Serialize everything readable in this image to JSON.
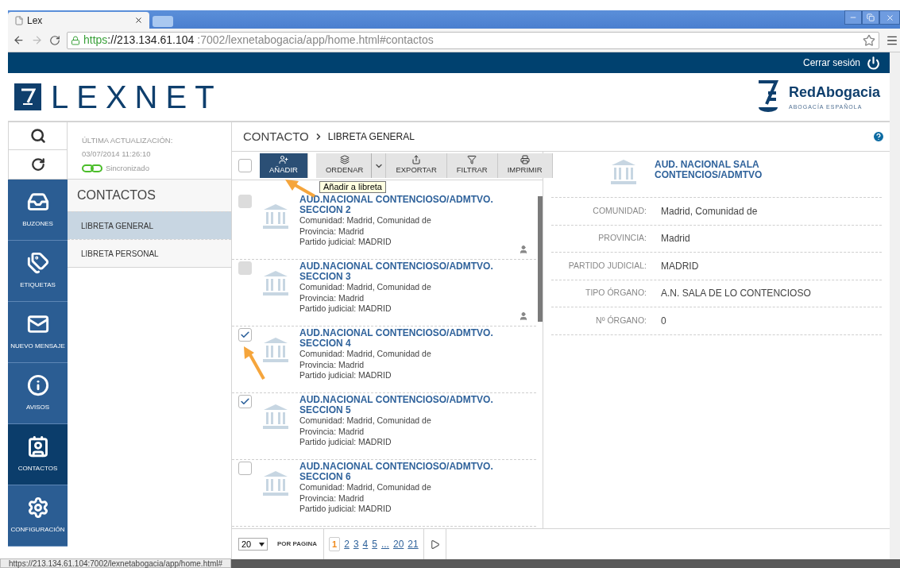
{
  "browser": {
    "tab_title": "Lex",
    "url_scheme": "https",
    "url_host": "://213.134.61.104",
    "url_rest": ":7002/lexnetabogacia/app/home.html#contactos",
    "status_url": "https://213.134.61.104:7002/lexnetabogacia/app/home.html#"
  },
  "header": {
    "logout": "Cerrar sesión",
    "brand": "LEXNET",
    "partner": "RedAbogacia",
    "partner_sub": "ABOGACÍA ESPAÑOLA"
  },
  "sidebar": {
    "items": [
      {
        "label": "BUZONES",
        "kind": "inbox",
        "selected": false
      },
      {
        "label": "ETIQUETAS",
        "kind": "tag",
        "selected": false
      },
      {
        "label": "NUEVO MENSAJE",
        "kind": "mail",
        "selected": false
      },
      {
        "label": "AVISOS",
        "kind": "info",
        "selected": false
      },
      {
        "label": "CONTACTOS",
        "kind": "contacts",
        "selected": true
      },
      {
        "label": "CONFIGURACIÓN",
        "kind": "settings",
        "selected": false
      }
    ]
  },
  "sync": {
    "label": "ÚLTIMA ACTUALIZACIÓN:",
    "time": "03/07/2014 11:26:10",
    "status": "Sincronizado"
  },
  "section": {
    "title": "CONTACTOS",
    "items": [
      {
        "label": "LIBRETA GENERAL",
        "selected": true
      },
      {
        "label": "LIBRETA PERSONAL",
        "selected": false
      }
    ]
  },
  "breadcrumb": [
    "CONTACTO",
    "LIBRETA GENERAL"
  ],
  "toolbar": {
    "select_all_checked": false,
    "buttons": [
      {
        "label": "AÑADIR",
        "kind": "add",
        "primary": true,
        "dropdown": false
      },
      {
        "label": "ORDENAR",
        "kind": "sort",
        "primary": false,
        "dropdown": true
      },
      {
        "label": "EXPORTAR",
        "kind": "export",
        "primary": false,
        "dropdown": false
      },
      {
        "label": "FILTRAR",
        "kind": "filter",
        "primary": false,
        "dropdown": false
      },
      {
        "label": "IMPRIMIR",
        "kind": "print",
        "primary": false,
        "dropdown": false
      }
    ],
    "tooltip": "Añadir a libreta"
  },
  "contacts": [
    {
      "title": "AUD.NACIONAL CONTENCIOSO/ADMTVO. SECCION 2",
      "lines": [
        "Comunidad: Madrid, Comunidad de",
        "Provincia: Madrid",
        "Partido judicial: MADRID"
      ],
      "checked": false,
      "disabled": true,
      "personal": true
    },
    {
      "title": "AUD.NACIONAL CONTENCIOSO/ADMTVO. SECCION 3",
      "lines": [
        "Comunidad: Madrid, Comunidad de",
        "Provincia: Madrid",
        "Partido judicial: MADRID"
      ],
      "checked": false,
      "disabled": true,
      "personal": true
    },
    {
      "title": "AUD.NACIONAL CONTENCIOSO/ADMTVO. SECCION 4",
      "lines": [
        "Comunidad: Madrid, Comunidad de",
        "Provincia: Madrid",
        "Partido judicial: MADRID"
      ],
      "checked": true,
      "disabled": false,
      "personal": false
    },
    {
      "title": "AUD.NACIONAL CONTENCIOSO/ADMTVO. SECCION 5",
      "lines": [
        "Comunidad: Madrid, Comunidad de",
        "Provincia: Madrid",
        "Partido judicial: MADRID"
      ],
      "checked": true,
      "disabled": false,
      "personal": false
    },
    {
      "title": "AUD.NACIONAL CONTENCIOSO/ADMTVO. SECCION 6",
      "lines": [
        "Comunidad: Madrid, Comunidad de",
        "Provincia: Madrid",
        "Partido judicial: MADRID"
      ],
      "checked": false,
      "disabled": false,
      "personal": false
    }
  ],
  "detail": {
    "title": "AUD. NACIONAL SALA CONTENCIOS/ADMTVO",
    "fields": [
      {
        "label": "COMUNIDAD:",
        "value": "Madrid, Comunidad de"
      },
      {
        "label": "PROVINCIA:",
        "value": "Madrid"
      },
      {
        "label": "PARTIDO JUDICIAL:",
        "value": "MADRID"
      },
      {
        "label": "TIPO ÓRGANO:",
        "value": "A.N. SALA DE LO CONTENCIOSO"
      },
      {
        "label": "Nº ÓRGANO:",
        "value": "0"
      }
    ]
  },
  "pagination": {
    "per_page": "20",
    "per_page_label": "POR PAGINA",
    "pages": [
      {
        "label": "1",
        "selected": true
      },
      {
        "label": "2",
        "selected": false
      },
      {
        "label": "3",
        "selected": false
      },
      {
        "label": "4",
        "selected": false
      },
      {
        "label": "5",
        "selected": false
      },
      {
        "label": "...",
        "selected": false
      },
      {
        "label": "20",
        "selected": false
      },
      {
        "label": "21",
        "selected": false
      }
    ]
  }
}
